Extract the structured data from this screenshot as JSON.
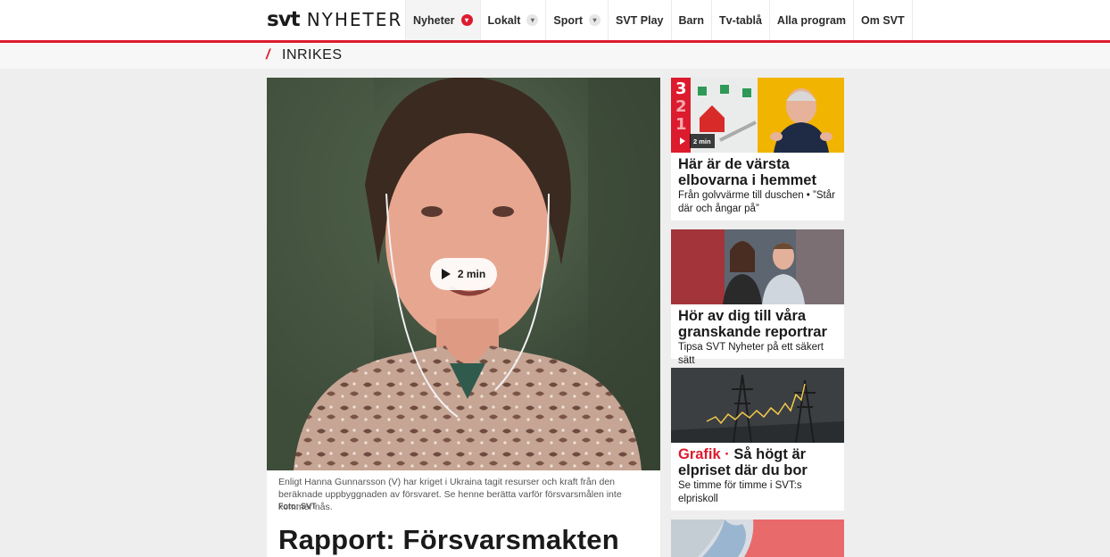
{
  "header": {
    "logo_svt": "svt",
    "logo_nyheter": "NYHETER",
    "nav": [
      {
        "label": "Nyheter",
        "dropdown": true,
        "active": true
      },
      {
        "label": "Lokalt",
        "dropdown": true
      },
      {
        "label": "Sport",
        "dropdown": true
      },
      {
        "label": "SVT Play"
      },
      {
        "label": "Barn"
      },
      {
        "label": "Tv-tablå"
      },
      {
        "label": "Alla program"
      },
      {
        "label": "Om SVT"
      }
    ]
  },
  "section": {
    "slash": "/",
    "title": "INRIKES"
  },
  "article": {
    "play_label": "2 min",
    "caption": "Enligt Hanna Gunnarsson (V) har kriget i Ukraina tagit resurser och kraft från den beräkna­de uppbyggnaden av försvaret. Se henne berätta varför försvarsmålen inte kommer nås.",
    "credit": "Foto: SVT",
    "headline": "Rapport: Försvarsmakten"
  },
  "cards": [
    {
      "badge": "2 min",
      "title": "Här är de värsta elbovarna i hemmet",
      "text": "Från golvvärme till duschen • ”Står där och ångar på”"
    },
    {
      "title": "Hör av dig till våra granskande reportrar",
      "text": "Tipsa SVT Nyheter på ett säkert sätt"
    },
    {
      "label": "Grafik ·",
      "title": "Så högt är elpriset där du bor",
      "text": "Se timme för timme i SVT:s elpriskoll"
    }
  ],
  "colors": {
    "accent": "#dc1c2e"
  }
}
